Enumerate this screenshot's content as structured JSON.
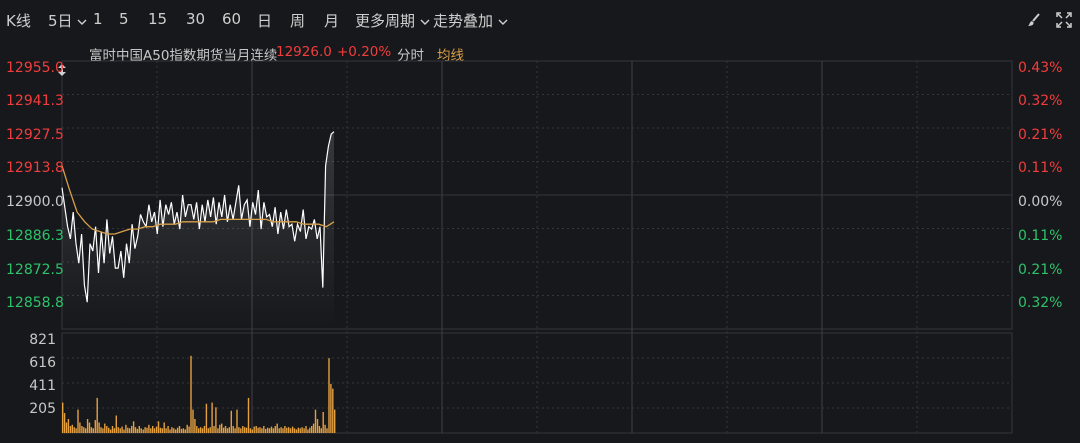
{
  "toolbar": {
    "kline_label": "K线",
    "day_select": "5日",
    "periods": [
      "1",
      "5",
      "15",
      "30",
      "60",
      "日",
      "周",
      "月"
    ],
    "more_periods": "更多周期",
    "overlay": "走势叠加",
    "icons": [
      "brush-icon",
      "expand-icon"
    ]
  },
  "info": {
    "instrument": "富时中国A50指数期货当月连续",
    "price": "12926.0",
    "change": "+0.20%",
    "mode": "分时",
    "avg_label": "均线"
  },
  "colors": {
    "up": "#f23d3d",
    "down": "#2ec26b",
    "neutral": "#c8c8c8",
    "avg_line": "#d9a04a",
    "price_line": "#ffffff",
    "volume": "#e5a040",
    "grid": "#33363c",
    "background": "#17181b"
  },
  "price_axis": {
    "left_labels": [
      "12955.0",
      "12941.3",
      "12927.5",
      "12913.8",
      "12900.0",
      "12886.3",
      "12872.5",
      "12858.8"
    ],
    "right_labels": [
      "0.43%",
      "0.32%",
      "0.21%",
      "0.11%",
      "0.00%",
      "0.11%",
      "0.21%",
      "0.32%"
    ],
    "label_colors": [
      "up",
      "up",
      "up",
      "up",
      "neutral",
      "down",
      "down",
      "down"
    ]
  },
  "volume_axis": {
    "labels": [
      "821",
      "616",
      "411",
      "205"
    ]
  },
  "chart_data": {
    "type": "line",
    "days_shown": 5,
    "y_range": [
      12845.0,
      12955.0
    ],
    "prev_close": 12900.0,
    "series": [
      {
        "values": [
          12903,
          12895,
          12887,
          12882,
          12893,
          12880,
          12872,
          12884,
          12863,
          12856,
          12880,
          12877,
          12887,
          12868,
          12885,
          12872,
          12890,
          12876,
          12883,
          12870,
          12870,
          12877,
          12866,
          12880,
          12872,
          12888,
          12878,
          12883,
          12892,
          12889,
          12887,
          12896,
          12889,
          12893,
          12884,
          12898,
          12887,
          12896,
          12892,
          12897,
          12888,
          12893,
          12886,
          12900,
          12891,
          12896,
          12896,
          12890,
          12897,
          12886,
          12896,
          12889,
          12898,
          12891,
          12899,
          12888,
          12897,
          12891,
          12900,
          12889,
          12896,
          12890,
          12897,
          12904,
          12890,
          12896,
          12898,
          12887,
          12897,
          12892,
          12902,
          12886,
          12897,
          12891,
          12892,
          12887,
          12895,
          12884,
          12893,
          12886,
          12894,
          12887,
          12888,
          12881,
          12888,
          12885,
          12894,
          12882,
          12887,
          12886,
          12890,
          12882,
          12887,
          12862,
          12912,
          12920,
          12925,
          12926
        ]
      },
      {
        "values": [
          12912,
          12902,
          12893,
          12889,
          12886,
          12885,
          12884,
          12884,
          12885,
          12886,
          12886,
          12887,
          12887,
          12888,
          12888,
          12888,
          12889,
          12889,
          12889,
          12889,
          12889,
          12890,
          12890,
          12890,
          12890,
          12890,
          12890,
          12890,
          12889,
          12889,
          12889,
          12889,
          12888,
          12888,
          12888,
          12887,
          12889
        ]
      }
    ],
    "volume": [
      260,
      170,
      90,
      120,
      60,
      70,
      50,
      40,
      200,
      90,
      60,
      50,
      40,
      120,
      90,
      50,
      40,
      110,
      300,
      90,
      50,
      40,
      80,
      60,
      45,
      30,
      60,
      40,
      150,
      50,
      40,
      55,
      30,
      70,
      45,
      40,
      60,
      100,
      50,
      35,
      60,
      40,
      30,
      50,
      45,
      70,
      40,
      60,
      40,
      55,
      100,
      45,
      40,
      90,
      40,
      60,
      30,
      50,
      40,
      30,
      45,
      60,
      35,
      40,
      30,
      70,
      55,
      660,
      200,
      120,
      60,
      40,
      50,
      40,
      60,
      250,
      40,
      50,
      260,
      60,
      220,
      40,
      70,
      80,
      45,
      60,
      40,
      50,
      190,
      60,
      40,
      200,
      50,
      40,
      60,
      50,
      45,
      300,
      40,
      30,
      55,
      60,
      45,
      50,
      40,
      60,
      35,
      45,
      40,
      55,
      40,
      60,
      80,
      40,
      50,
      40,
      60,
      45,
      50,
      40,
      55,
      40,
      30,
      45,
      40,
      50,
      40,
      60,
      30,
      45,
      60,
      80,
      200,
      120,
      60,
      40,
      180,
      70,
      40,
      640,
      420,
      380,
      200
    ]
  }
}
